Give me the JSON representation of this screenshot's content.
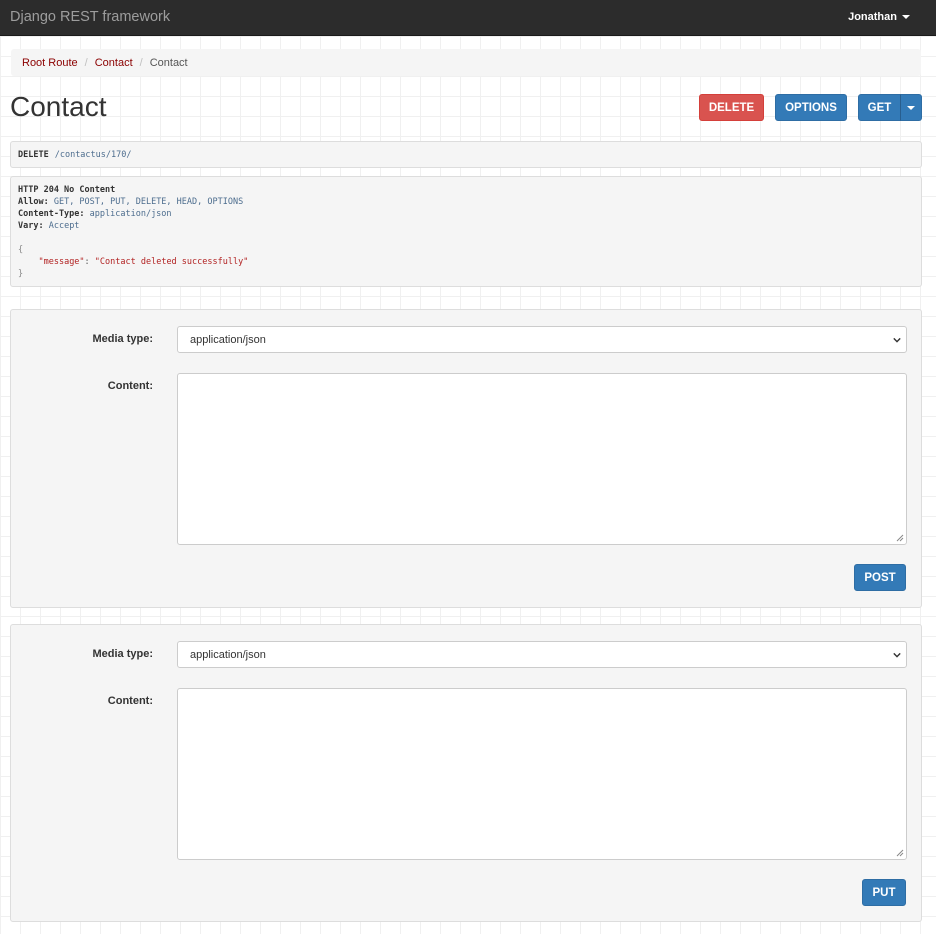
{
  "navbar": {
    "brand": "Django REST framework",
    "user": "Jonathan"
  },
  "breadcrumb": [
    {
      "label": "Root Route",
      "active": false
    },
    {
      "label": "Contact",
      "active": false
    },
    {
      "label": "Contact",
      "active": true
    }
  ],
  "page": {
    "title": "Contact"
  },
  "actions": {
    "delete_label": "DELETE",
    "options_label": "OPTIONS",
    "get_label": "GET"
  },
  "request": {
    "method": "DELETE",
    "path": "/contactus/170/"
  },
  "response": {
    "status": "HTTP 204 No Content",
    "headers": [
      {
        "key": "Allow:",
        "value": "GET, POST, PUT, DELETE, HEAD, OPTIONS"
      },
      {
        "key": "Content-Type:",
        "value": "application/json"
      },
      {
        "key": "Vary:",
        "value": "Accept"
      }
    ],
    "body_open": "{",
    "body_key": "\"message\"",
    "body_colon": ":",
    "body_value": "\"Contact deleted successfully\"",
    "body_close": "}"
  },
  "post_form": {
    "media_type_label": "Media type:",
    "media_type_value": "application/json",
    "content_label": "Content:",
    "content_value": "",
    "submit_label": "POST"
  },
  "put_form": {
    "media_type_label": "Media type:",
    "media_type_value": "application/json",
    "content_label": "Content:",
    "content_value": "",
    "submit_label": "PUT"
  },
  "colors": {
    "navbar_bg": "#2c2c2c",
    "danger": "#d9534f",
    "primary": "#337ab7",
    "breadcrumb_link": "#8b0000"
  },
  "icons": [
    "caret-down-icon",
    "chevron-down-icon",
    "resize-grip-icon"
  ]
}
